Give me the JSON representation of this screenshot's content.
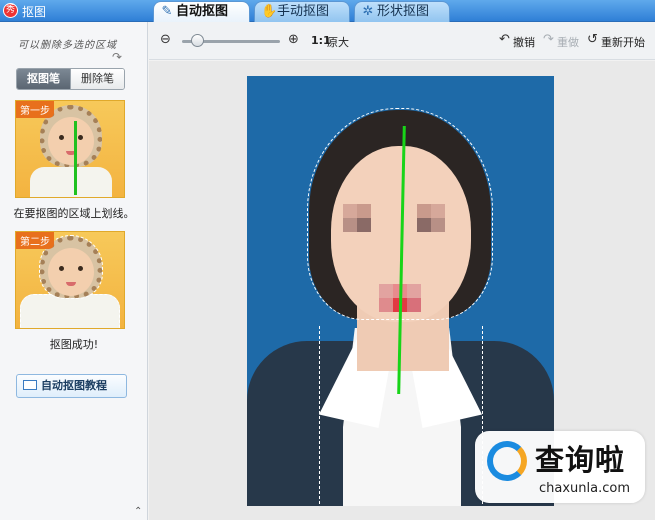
{
  "window": {
    "title": "抠图",
    "app_icon": "xiu-icon"
  },
  "tabs": [
    {
      "label": "自动抠图",
      "icon": "brush-icon",
      "active": true
    },
    {
      "label": "手动抠图",
      "icon": "hand-icon",
      "active": false
    },
    {
      "label": "形状抠图",
      "icon": "gear-shape-icon",
      "active": false
    }
  ],
  "left_panel": {
    "hint": "可以删除多选的区域",
    "segment": {
      "pen_label": "抠图笔",
      "eraser_label": "删除笔",
      "selected": "抠图笔"
    },
    "step1": {
      "badge": "第一步",
      "caption": "在要抠图的区域上划线。"
    },
    "step2": {
      "badge": "第二步",
      "caption": "抠图成功!"
    },
    "tutorial_button": "自动抠图教程"
  },
  "toolbar": {
    "zoom_out_icon": "zoom-out-icon",
    "zoom_in_icon": "zoom-in-icon",
    "zoom_level": 0.15,
    "ratio_label": "1:1",
    "original_label": "原大",
    "undo_label": "撤销",
    "redo_label": "重做",
    "reset_label": "重新开始"
  },
  "watermark": {
    "main": "查询啦",
    "url": "chaxunla.com"
  },
  "colors": {
    "titlebar": "#2f7fd6",
    "photo_bg": "#1e6aa8",
    "stroke": "#18d418",
    "badge": "#e8701c"
  }
}
